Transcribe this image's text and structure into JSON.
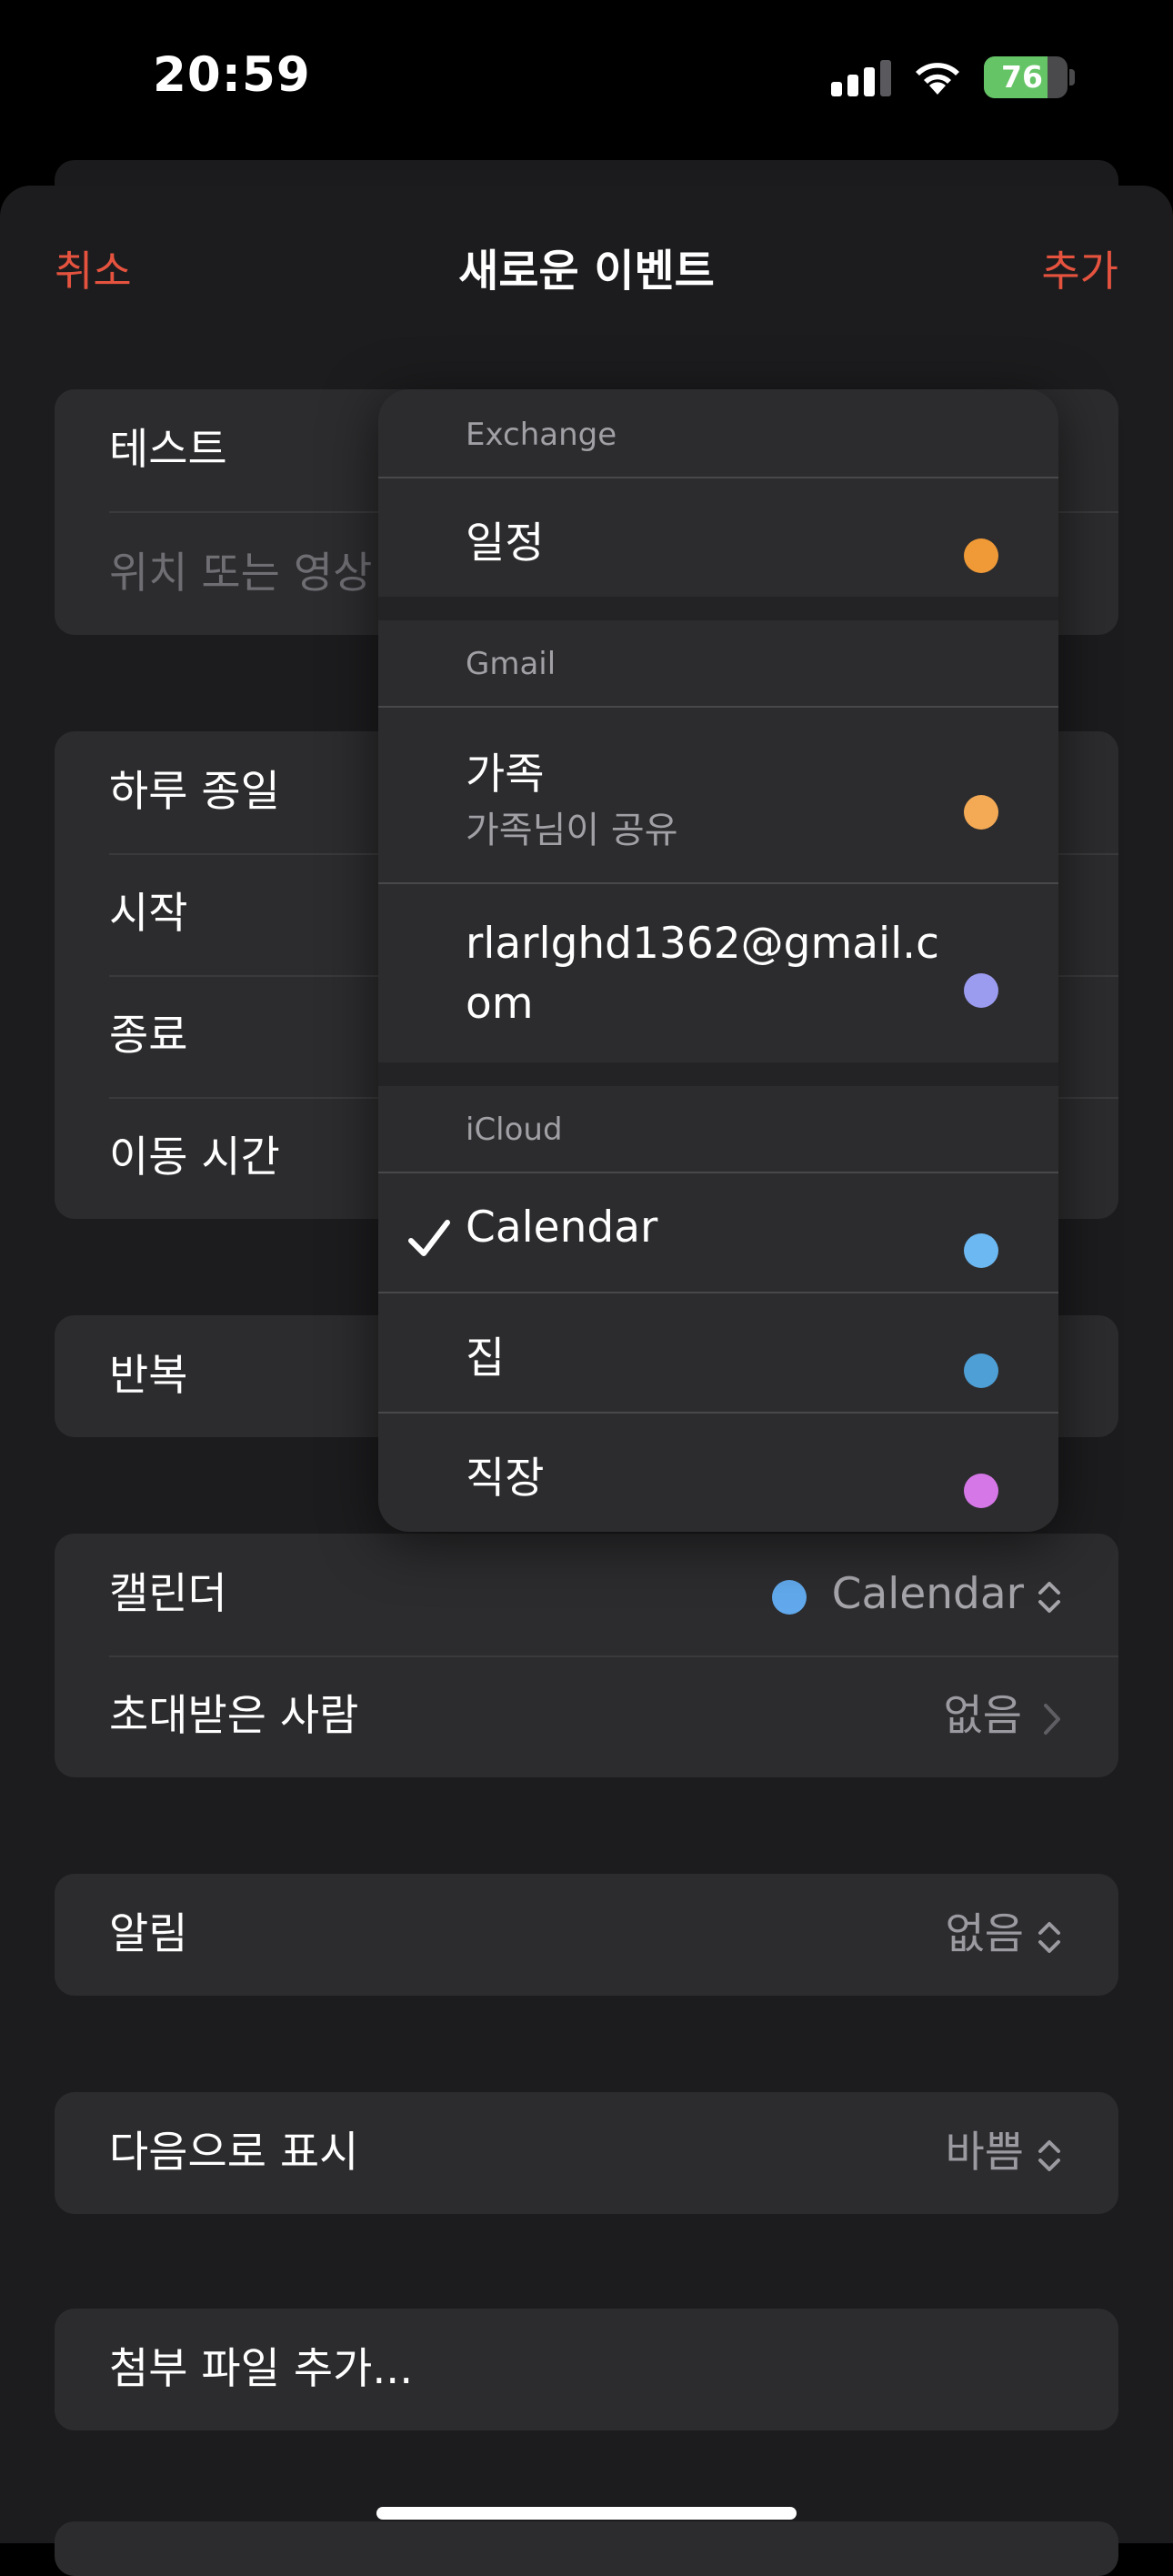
{
  "status_bar": {
    "time": "20:59",
    "battery_level": "76",
    "battery_fraction": 0.76,
    "signal_bars": 3
  },
  "nav": {
    "cancel": "취소",
    "title": "새로운 이벤트",
    "add": "추가"
  },
  "event": {
    "title_value": "테스트",
    "location_placeholder": "위치 또는 영상"
  },
  "time_group": {
    "all_day": "하루 종일",
    "start": "시작",
    "end": "종료",
    "travel_time": "이동 시간"
  },
  "repeat": {
    "label": "반복"
  },
  "calendar_row": {
    "label": "캘린더",
    "value": "Calendar",
    "dot_color": "#61a9ec"
  },
  "invitees": {
    "label": "초대받은 사람",
    "value": "없음"
  },
  "alert": {
    "label": "알림",
    "value": "없음"
  },
  "show_as": {
    "label": "다음으로 표시",
    "value": "바쁨"
  },
  "attachment": {
    "label": "첨부 파일 추가..."
  },
  "calendar_menu": {
    "sections": [
      {
        "header": "Exchange",
        "items": [
          {
            "name": "일정",
            "color": "#f09a37"
          }
        ]
      },
      {
        "header": "Gmail",
        "items": [
          {
            "name": "가족",
            "subtitle": "가족님이 공유",
            "color": "#f4aa55"
          },
          {
            "name_line1": "rlarlghd1362@gmail.c",
            "name_line2": "om",
            "color": "#9b9bf0"
          }
        ]
      },
      {
        "header": "iCloud",
        "items": [
          {
            "name": "Calendar",
            "color": "#6cb8f2",
            "selected": true
          },
          {
            "name": "집",
            "color": "#4d9fd6"
          },
          {
            "name": "직장",
            "color": "#d677e8"
          }
        ]
      }
    ]
  }
}
